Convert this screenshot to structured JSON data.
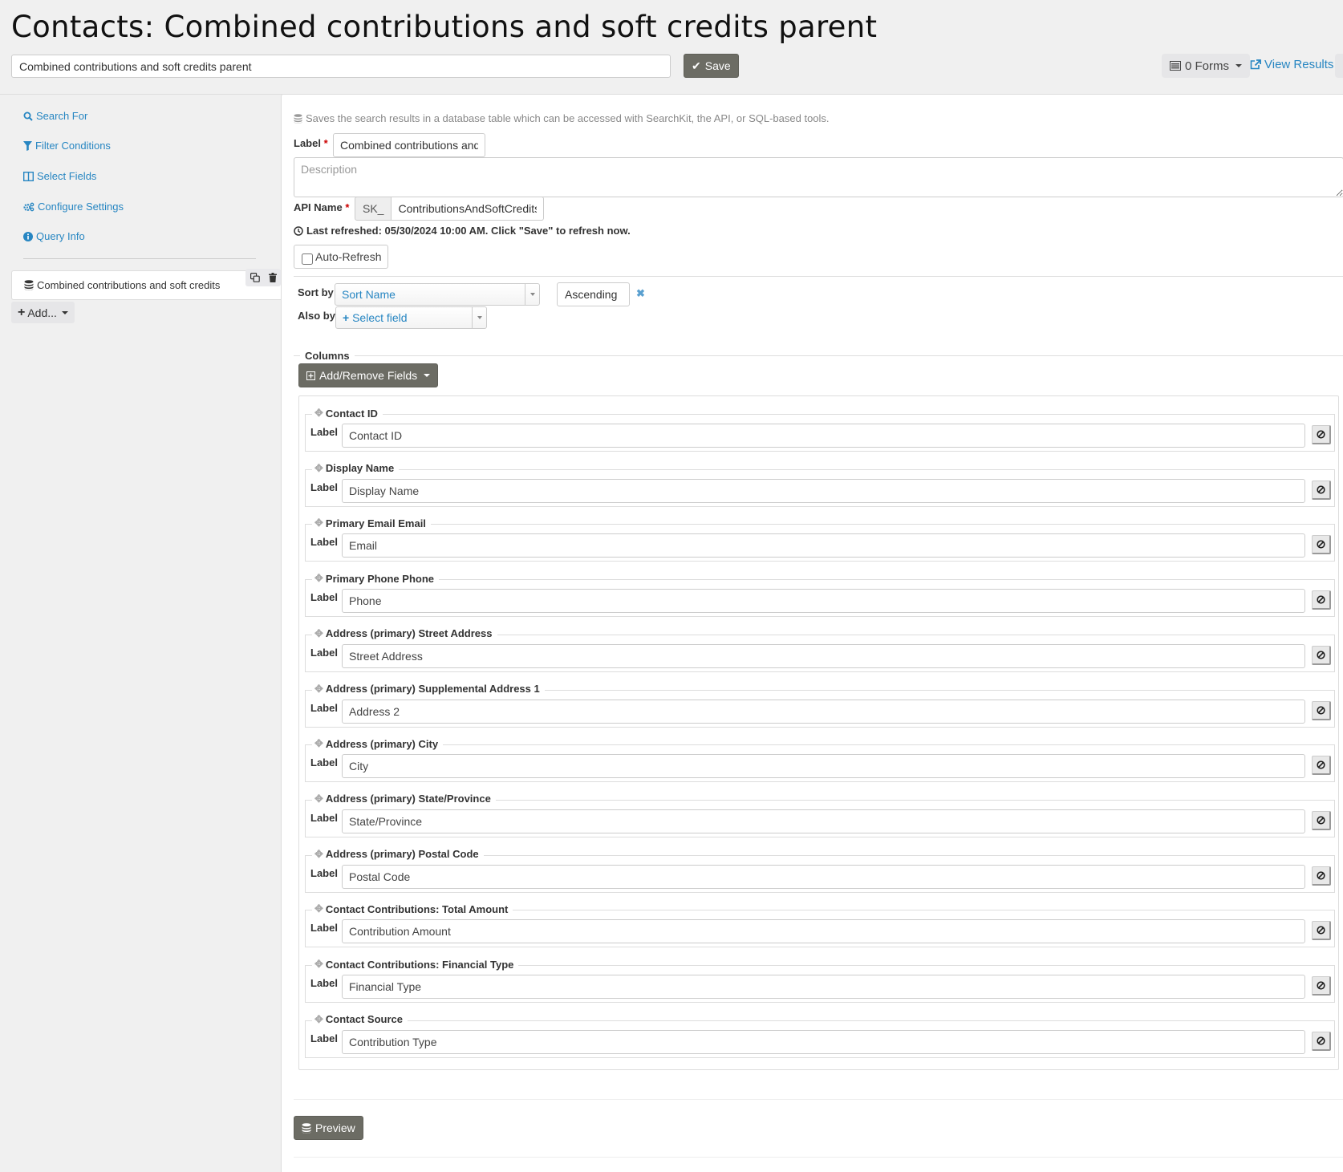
{
  "header": {
    "title": "Contacts: Combined contributions and soft credits parent",
    "title_input_value": "Combined contributions and soft credits parent",
    "save_label": "Save",
    "forms_label": "0 Forms",
    "view_results_label": "View Results"
  },
  "sidebar": {
    "items": [
      {
        "label": "Search For",
        "icon": "search-icon"
      },
      {
        "label": "Filter Conditions",
        "icon": "filter-icon"
      },
      {
        "label": "Select Fields",
        "icon": "columns-icon"
      },
      {
        "label": "Configure Settings",
        "icon": "gears-icon"
      },
      {
        "label": "Query Info",
        "icon": "info-circle-icon"
      }
    ],
    "saved_display": "Combined contributions and soft credits",
    "add_label": "Add..."
  },
  "main": {
    "help_text": "Saves the search results in a database table which can be accessed with SearchKit, the API, or SQL-based tools.",
    "label_field": {
      "label": "Label",
      "required": "*",
      "value": "Combined contributions and soft credits parent"
    },
    "description": {
      "placeholder": "Description",
      "value": ""
    },
    "api_name": {
      "label": "API Name",
      "required": "*",
      "prefix": "SK_",
      "value": "ContributionsAndSoftCredits"
    },
    "last_refreshed": "Last refreshed: 05/30/2024 10:00 AM. Click \"Save\" to refresh now.",
    "auto_refresh": {
      "label": "Auto-Refresh",
      "checked": false
    },
    "sort": {
      "sort_by_label": "Sort by",
      "sort_by_value": "Sort Name",
      "direction": "Ascending",
      "also_by_label": "Also by",
      "also_by_value": "Select field"
    },
    "columns_legend": "Columns",
    "add_remove_label": "Add/Remove Fields",
    "columns": [
      {
        "field": "Contact ID",
        "label_caption": "Label",
        "label": "Contact ID"
      },
      {
        "field": "Display Name",
        "label_caption": "Label",
        "label": "Display Name"
      },
      {
        "field": "Primary Email Email",
        "label_caption": "Label",
        "label": "Email"
      },
      {
        "field": "Primary Phone Phone",
        "label_caption": "Label",
        "label": "Phone"
      },
      {
        "field": "Address (primary) Street Address",
        "label_caption": "Label",
        "label": "Street Address"
      },
      {
        "field": "Address (primary) Supplemental Address 1",
        "label_caption": "Label",
        "label": "Address 2"
      },
      {
        "field": "Address (primary) City",
        "label_caption": "Label",
        "label": "City"
      },
      {
        "field": "Address (primary) State/Province",
        "label_caption": "Label",
        "label": "State/Province"
      },
      {
        "field": "Address (primary) Postal Code",
        "label_caption": "Label",
        "label": "Postal Code"
      },
      {
        "field": "Contact Contributions: Total Amount",
        "label_caption": "Label",
        "label": "Contribution Amount"
      },
      {
        "field": "Contact Contributions: Financial Type",
        "label_caption": "Label",
        "label": "Financial Type"
      },
      {
        "field": "Contact Source",
        "label_caption": "Label",
        "label": "Contribution Type"
      }
    ],
    "preview_label": "Preview"
  },
  "colors": {
    "link": "#2786c2",
    "button_dark": "#6c6c64",
    "required": "#cc0000"
  }
}
